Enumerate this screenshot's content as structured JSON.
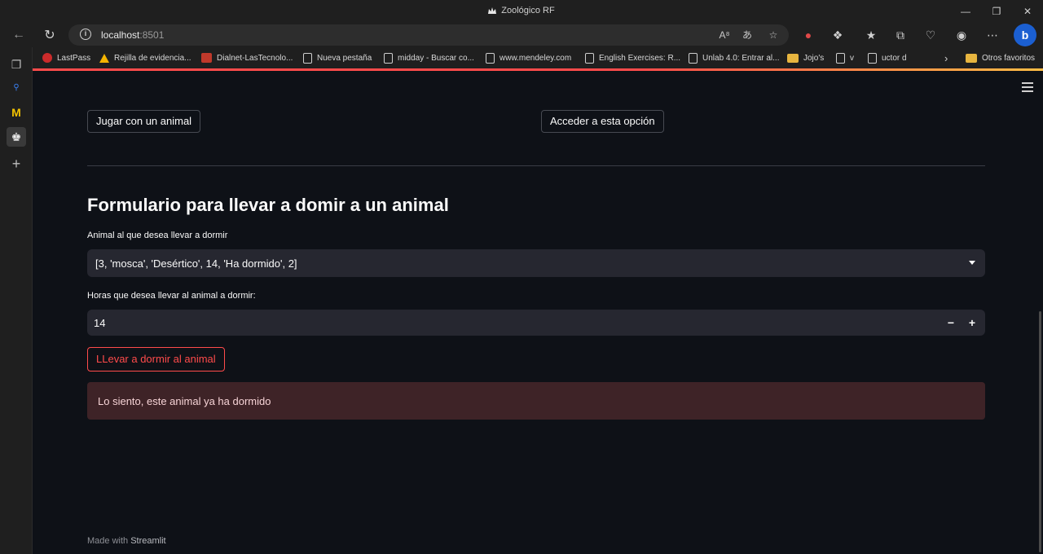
{
  "window": {
    "title": "Zoológico RF",
    "controls": [
      "minimize",
      "maximize",
      "close"
    ]
  },
  "address_bar": {
    "host": "localhost",
    "port": ":8501"
  },
  "bookmarks": [
    {
      "label": "LastPass",
      "icon": "lastpass-icon"
    },
    {
      "label": "Rejilla de evidencia...",
      "icon": "drive-icon"
    },
    {
      "label": "Dialnet-LasTecnolo...",
      "icon": "dialnet-icon"
    },
    {
      "label": "Nueva pestaña",
      "icon": "page-icon"
    },
    {
      "label": "midday - Buscar co...",
      "icon": "page-icon"
    },
    {
      "label": "www.mendeley.com",
      "icon": "page-icon"
    },
    {
      "label": "English Exercises: R...",
      "icon": "page-icon"
    },
    {
      "label": "Unlab 4.0: Entrar al...",
      "icon": "page-icon"
    },
    {
      "label": "Jojo's",
      "icon": "folder-icon"
    },
    {
      "label": "v",
      "icon": "page-icon"
    },
    {
      "label": "uctor d",
      "icon": "page-icon"
    },
    {
      "label": "Otros favoritos",
      "icon": "folder-icon"
    }
  ],
  "app": {
    "top_buttons": {
      "left": "Jugar con un animal",
      "right": "Acceder a esta opción"
    },
    "form": {
      "heading": "Formulario para llevar a domir a un animal",
      "animal_label": "Animal al que desea llevar a dormir",
      "animal_value": "[3, 'mosca', 'Desértico', 14, 'Ha dormido', 2]",
      "hours_label": "Horas que desea llevar al animal a dormir:",
      "hours_value": "14",
      "decrement": "−",
      "increment": "+",
      "submit_label": "LLevar a dormir al animal"
    },
    "alert": {
      "message": "Lo siento, este animal ya ha dormido",
      "type": "error"
    },
    "footer": {
      "prefix": "Made with",
      "brand": "Streamlit"
    }
  },
  "colors": {
    "background": "#0e1117",
    "widget": "#262730",
    "accent": "#ff4b4b",
    "error_bg": "#3e2327"
  }
}
